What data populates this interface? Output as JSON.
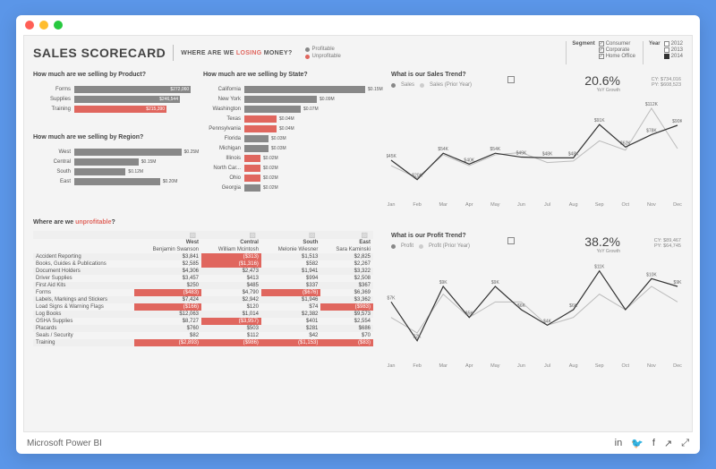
{
  "chrome": {
    "footer_brand": "Microsoft Power BI"
  },
  "header": {
    "title": "SALES SCORECARD",
    "subtitle_pre": "WHERE ARE WE ",
    "subtitle_emph": "LOSING",
    "subtitle_post": " MONEY?",
    "legend": [
      {
        "label": "Profitable",
        "cls": "grey"
      },
      {
        "label": "Unprofitable",
        "cls": "red"
      }
    ]
  },
  "slicers": {
    "segment": {
      "label": "Segment",
      "options": [
        {
          "label": "Consumer",
          "checked": true
        },
        {
          "label": "Corporate",
          "checked": true
        },
        {
          "label": "Home Office",
          "checked": true
        }
      ]
    },
    "year": {
      "label": "Year",
      "options": [
        {
          "label": "2012",
          "active": false
        },
        {
          "label": "2013",
          "active": false
        },
        {
          "label": "2014",
          "active": true
        }
      ]
    }
  },
  "sections": {
    "by_product": "How much are we selling by Product?",
    "by_region": "How much are we selling by Region?",
    "by_state": "How much are we selling by State?",
    "sales_trend": "What is our Sales Trend?",
    "profit_trend": "What is our Profit Trend?",
    "unprofitable_pre": "Where are we ",
    "unprofitable_emph": "unprofitable",
    "unprofitable_post": "?"
  },
  "kpi_sales": {
    "pct": "20.6%",
    "caption": "YoY Growth",
    "cy_label": "CY: $734,016",
    "py_label": "PY: $608,523"
  },
  "kpi_profit": {
    "pct": "38.2%",
    "caption": "YoY Growth",
    "cy_label": "CY: $89,467",
    "py_label": "PY: $64,745"
  },
  "legend_trend": {
    "a": "Sales",
    "b": "Sales (Prior Year)",
    "c": "Profit",
    "d": "Profit (Prior Year)"
  },
  "chart_data": {
    "by_product": {
      "type": "bar",
      "categories": [
        "Forms",
        "Supplies",
        "Training"
      ],
      "values": [
        272060,
        246544,
        215390
      ],
      "labels": [
        "$272,060",
        "$246,544",
        "$215,390"
      ],
      "unprofitable": [
        false,
        false,
        true
      ],
      "max": 280000
    },
    "by_region": {
      "type": "bar",
      "categories": [
        "West",
        "Central",
        "South",
        "East"
      ],
      "values": [
        0.25,
        0.15,
        0.12,
        0.2
      ],
      "labels": [
        "$0.25M",
        "$0.15M",
        "$0.12M",
        "$0.20M"
      ],
      "unprofitable": [
        false,
        false,
        false,
        false
      ],
      "max": 0.28
    },
    "by_state": {
      "type": "bar",
      "categories": [
        "California",
        "New York",
        "Washington",
        "Texas",
        "Pennsylvania",
        "Florida",
        "Michigan",
        "Illinois",
        "North Car...",
        "Ohio",
        "Georgia"
      ],
      "values": [
        0.15,
        0.09,
        0.07,
        0.04,
        0.04,
        0.03,
        0.03,
        0.02,
        0.02,
        0.02,
        0.02
      ],
      "labels": [
        "$0.15M",
        "$0.09M",
        "$0.07M",
        "$0.04M",
        "$0.04M",
        "$0.03M",
        "$0.03M",
        "$0.02M",
        "$0.02M",
        "$0.02M",
        "$0.02M"
      ],
      "unprofitable": [
        false,
        false,
        false,
        true,
        true,
        false,
        false,
        true,
        true,
        true,
        false
      ],
      "max": 0.16
    },
    "sales_trend": {
      "type": "line",
      "x": [
        "Jan",
        "Feb",
        "Mar",
        "Apr",
        "May",
        "Jun",
        "Jul",
        "Aug",
        "Sep",
        "Oct",
        "Nov",
        "Dec"
      ],
      "series": [
        {
          "name": "Sales",
          "values": [
            45,
            20,
            54,
            40,
            54,
            49,
            48,
            48,
            91,
            62,
            78,
            90
          ],
          "labels": [
            "$45K",
            "$20K",
            "$54K",
            "$40K",
            "$54K",
            "$49K",
            "$48K",
            "$48K",
            "$91K",
            "$62K",
            "$78K",
            "$90K"
          ]
        },
        {
          "name": "Sales (Prior Year)",
          "values": [
            38,
            22,
            52,
            38,
            52,
            55,
            42,
            44,
            70,
            58,
            112,
            60
          ]
        }
      ],
      "ylim": [
        0,
        120
      ],
      "highlight_label": "$112K"
    },
    "profit_trend": {
      "type": "line",
      "x": [
        "Jan",
        "Feb",
        "Mar",
        "Apr",
        "May",
        "Jun",
        "Jul",
        "Aug",
        "Sep",
        "Oct",
        "Nov",
        "Dec"
      ],
      "series": [
        {
          "name": "Profit",
          "values": [
            7,
            2,
            9,
            5,
            9,
            6,
            4,
            6,
            11,
            6,
            10,
            9
          ],
          "labels": [
            "$7K",
            "$2K",
            "$9K",
            "$5K",
            "$9K",
            "$6K",
            "$4K",
            "$6K",
            "$11K",
            "",
            "$10K",
            "$9K"
          ]
        },
        {
          "name": "Profit (Prior Year)",
          "values": [
            5,
            3,
            8,
            5,
            7,
            7,
            4,
            5,
            8,
            6,
            9,
            7
          ]
        }
      ],
      "ylim": [
        0,
        12
      ]
    },
    "matrix": {
      "type": "table",
      "columns": [
        "West",
        "Central",
        "South",
        "East"
      ],
      "column_people": [
        "Benjamin Swanson",
        "William Mcintosh",
        "Melonie Wiesner",
        "Sara Kaminski"
      ],
      "rows": [
        {
          "label": "Accident Reporting",
          "v": [
            "$3,841",
            "($313)",
            "$1,513",
            "$2,825"
          ],
          "neg": [
            0,
            1,
            0,
            0
          ]
        },
        {
          "label": "Books, Guides & Publications",
          "v": [
            "$2,585",
            "($1,316)",
            "$582",
            "$2,267"
          ],
          "neg": [
            0,
            1,
            0,
            0
          ]
        },
        {
          "label": "Document Holders",
          "v": [
            "$4,306",
            "$2,473",
            "$1,941",
            "$3,322"
          ],
          "neg": [
            0,
            0,
            0,
            0
          ]
        },
        {
          "label": "Driver Supplies",
          "v": [
            "$3,457",
            "$413",
            "$994",
            "$2,508"
          ],
          "neg": [
            0,
            0,
            0,
            0
          ]
        },
        {
          "label": "First Aid Kits",
          "v": [
            "$250",
            "$485",
            "$337",
            "$367"
          ],
          "neg": [
            0,
            0,
            0,
            0
          ]
        },
        {
          "label": "Forms",
          "v": [
            "($483)",
            "$4,790",
            "($676)",
            "$6,369"
          ],
          "neg": [
            1,
            0,
            1,
            0
          ]
        },
        {
          "label": "Labels, Markings and Stickers",
          "v": [
            "$7,424",
            "$2,942",
            "$1,946",
            "$3,362"
          ],
          "neg": [
            0,
            0,
            0,
            0
          ]
        },
        {
          "label": "Load Signs & Warning Flags",
          "v": [
            "($166)",
            "$120",
            "$74",
            "($983)"
          ],
          "neg": [
            1,
            0,
            0,
            1
          ]
        },
        {
          "label": "Log Books",
          "v": [
            "$12,063",
            "$1,014",
            "$2,382",
            "$9,573"
          ],
          "neg": [
            0,
            0,
            0,
            0
          ]
        },
        {
          "label": "OSHA Supplies",
          "v": [
            "$8,727",
            "($3,957)",
            "$401",
            "$2,554"
          ],
          "neg": [
            0,
            1,
            0,
            0
          ]
        },
        {
          "label": "Placards",
          "v": [
            "$760",
            "$503",
            "$281",
            "$686"
          ],
          "neg": [
            0,
            0,
            0,
            0
          ]
        },
        {
          "label": "Seals / Security",
          "v": [
            "$82",
            "$112",
            "$42",
            "$70"
          ],
          "neg": [
            0,
            0,
            0,
            0
          ]
        },
        {
          "label": "Training",
          "v": [
            "($2,893)",
            "($986)",
            "($1,153)",
            "($83)"
          ],
          "neg": [
            1,
            1,
            1,
            1
          ]
        }
      ]
    }
  }
}
